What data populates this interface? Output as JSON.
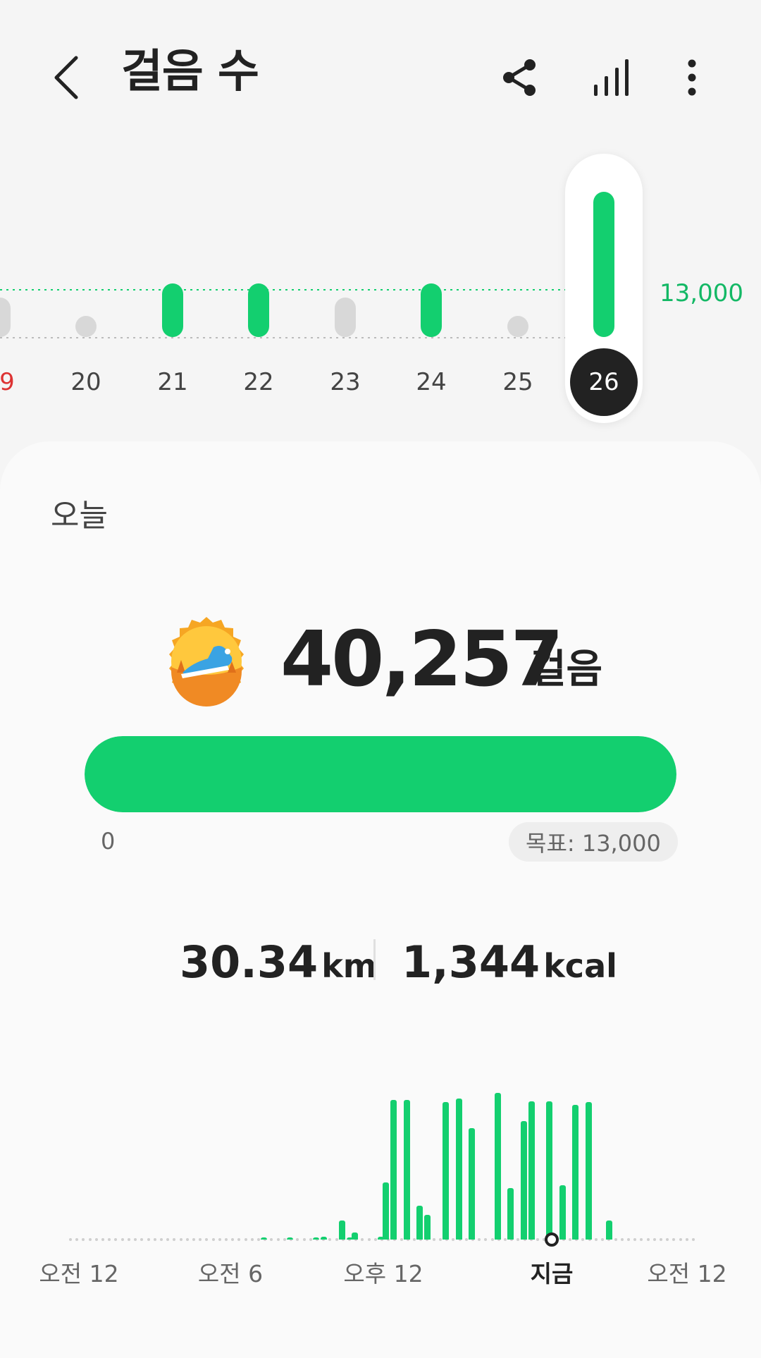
{
  "header": {
    "title": "걸음 수",
    "back_icon": "chevron-left-icon",
    "share_icon": "share-icon",
    "stats_icon": "bar-chart-icon",
    "more_icon": "more-vertical-icon"
  },
  "week": {
    "days": [
      {
        "label": "9",
        "kind": "partial-sunday",
        "status": "below-goal"
      },
      {
        "label": "20",
        "status": "none"
      },
      {
        "label": "21",
        "status": "goal-met"
      },
      {
        "label": "22",
        "status": "goal-met"
      },
      {
        "label": "23",
        "status": "below-goal"
      },
      {
        "label": "24",
        "status": "goal-met"
      },
      {
        "label": "25",
        "status": "none"
      },
      {
        "label": "26",
        "status": "selected"
      }
    ],
    "goal_line_label": "13,000",
    "colors": {
      "green": "#13cf6f",
      "gray": "#d8d8d8",
      "sunday": "#dd3333"
    }
  },
  "card": {
    "title": "오늘",
    "steps_value": "40,257",
    "steps_unit": "걸음",
    "progress_fraction": 1.0,
    "progress_min_label": "0",
    "goal_label": "목표: 13,000",
    "distance_value": "30.34",
    "distance_unit": "km",
    "calories_value": "1,344",
    "calories_unit": "kcal",
    "badge_icon": "running-shoe-badge-icon"
  },
  "hourly_chart": {
    "axis_labels": [
      "오전 12",
      "오전 6",
      "오후 12",
      "지금",
      "오전 12"
    ],
    "now_label": "지금"
  },
  "chart_data": {
    "type": "bar",
    "title": "",
    "xlabel": "",
    "ylabel": "",
    "x_unit": "hour of day",
    "x": [
      7.5,
      8.5,
      9.5,
      9.8,
      10.5,
      10.8,
      11.0,
      12.0,
      12.2,
      12.5,
      13.0,
      13.5,
      13.8,
      14.5,
      15.0,
      15.5,
      16.5,
      17.0,
      17.5,
      17.8,
      18.5,
      19.0,
      19.5,
      20.0,
      20.8
    ],
    "values": [
      1,
      1,
      1,
      2,
      14,
      1,
      5,
      2,
      42,
      103,
      103,
      25,
      18,
      101,
      104,
      82,
      108,
      38,
      87,
      102,
      102,
      40,
      99,
      101,
      14
    ],
    "ylim": [
      0,
      108
    ],
    "grid": false,
    "legend": "none"
  }
}
